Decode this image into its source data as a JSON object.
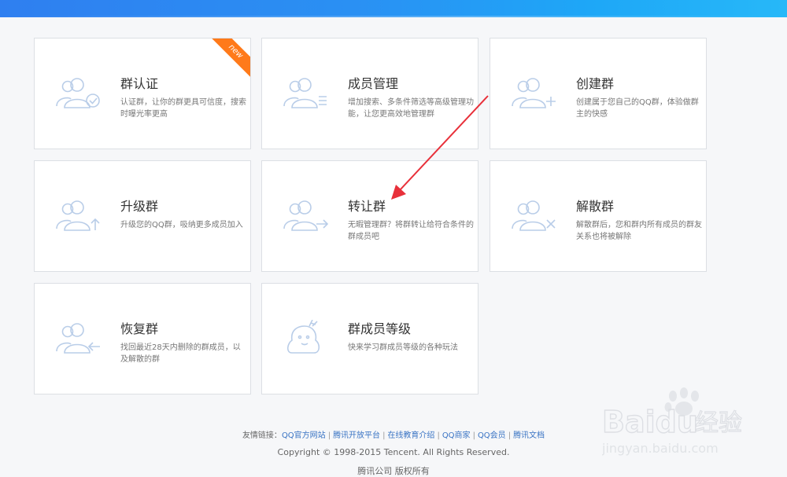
{
  "cards": [
    {
      "title": "群认证",
      "desc": "认证群，让你的群更具可信度，搜索时曝光率更高",
      "badge": "new",
      "icon": "group-verified-icon"
    },
    {
      "title": "成员管理",
      "desc": "增加搜索、多条件筛选等高级管理功能，让您更高效地管理群",
      "icon": "group-list-icon"
    },
    {
      "title": "创建群",
      "desc": "创建属于您自己的QQ群，体验做群主的快感",
      "icon": "group-add-icon"
    },
    {
      "title": "升级群",
      "desc": "升级您的QQ群，吸纳更多成员加入",
      "icon": "group-upgrade-icon"
    },
    {
      "title": "转让群",
      "desc": "无暇管理群？将群转让给符合条件的群成员吧",
      "icon": "group-transfer-icon"
    },
    {
      "title": "解散群",
      "desc": "解散群后，您和群内所有成员的群友关系也将被解除",
      "icon": "group-dismiss-icon"
    },
    {
      "title": "恢复群",
      "desc": "找回最近28天内删除的群成员，以及解散的群",
      "icon": "group-restore-icon"
    },
    {
      "title": "群成员等级",
      "desc": "快来学习群成员等级的各种玩法",
      "icon": "member-level-icon"
    }
  ],
  "footer": {
    "links_label": "友情链接：",
    "links": [
      "QQ官方网站",
      "腾讯开放平台",
      "在线教育介绍",
      "QQ商家",
      "QQ会员",
      "腾讯文档"
    ],
    "separator": "|",
    "copyright": "Copyright © 1998-2015 Tencent. All Rights Reserved.",
    "company": "腾讯公司 版权所有"
  },
  "watermark": {
    "brand": "Baidu",
    "brand_cn": "经验",
    "url": "jingyan.baidu.com"
  },
  "colors": {
    "accent": "#2f8ef2",
    "ribbon": "#ff7a1a",
    "arrow": "#e8303a",
    "icon": "#b9cde8"
  }
}
